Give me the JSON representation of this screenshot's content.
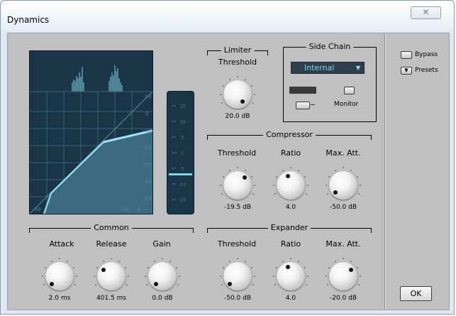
{
  "window": {
    "title": "Dynamics",
    "close_icon": "close-icon"
  },
  "graph": {
    "db_scale": [
      "-10",
      "0",
      "-10",
      "-20",
      "-30",
      "-40",
      "-50"
    ],
    "x_labels": [
      "-50",
      "-10",
      "0"
    ]
  },
  "meter": {
    "scale": [
      "15",
      "10",
      "5",
      "0",
      "-5",
      "-10",
      "-15"
    ]
  },
  "limiter": {
    "group_label": "Limiter",
    "threshold_label": "Threshold",
    "threshold_value": "20.0 dB"
  },
  "side_chain": {
    "group_label": "Side Chain",
    "source": "Internal",
    "monitor_label": "Monitor"
  },
  "compressor": {
    "group_label": "Compressor",
    "threshold_label": "Threshold",
    "threshold_value": "-19.5 dB",
    "ratio_label": "Ratio",
    "ratio_value": "4.0",
    "maxatt_label": "Max. Att.",
    "maxatt_value": "-50.0 dB"
  },
  "common": {
    "group_label": "Common",
    "attack_label": "Attack",
    "attack_value": "2.0 ms",
    "release_label": "Release",
    "release_value": "401.5 ms",
    "gain_label": "Gain",
    "gain_value": "0.0 dB"
  },
  "expander": {
    "group_label": "Expander",
    "threshold_label": "Threshold",
    "threshold_value": "-50.0 dB",
    "ratio_label": "Ratio",
    "ratio_value": "4.0",
    "maxatt_label": "Max. Att.",
    "maxatt_value": "-20.0 dB"
  },
  "right_panel": {
    "bypass_label": "Bypass",
    "presets_label": "Presets",
    "ok_label": "OK"
  },
  "colors": {
    "display_bg": "#1a3547",
    "accent": "#7fd3ea",
    "panel": "#c0c0c0"
  }
}
